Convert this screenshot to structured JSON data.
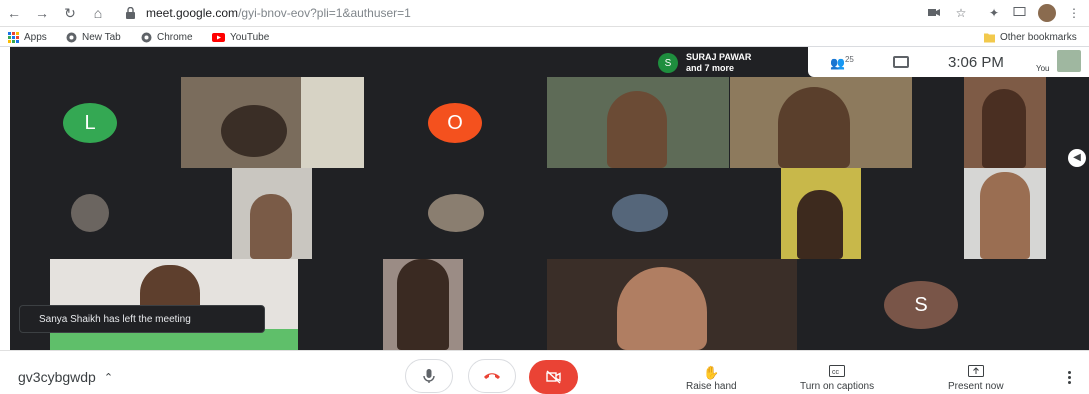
{
  "browser": {
    "url_host": "meet.google.com",
    "url_path": "/gyi-bnov-eov?pli=1&authuser=1",
    "nav_icons": [
      "back-arrow-icon",
      "forward-arrow-icon",
      "reload-icon",
      "home-icon"
    ],
    "bookmarks": [
      {
        "label": "Apps",
        "icon": "apps-grid-icon",
        "color": "#e37400"
      },
      {
        "label": "New Tab",
        "icon": "chrome-icon",
        "color": "#5f6368"
      },
      {
        "label": "Chrome",
        "icon": "chrome-icon",
        "color": "#5f6368"
      },
      {
        "label": "YouTube",
        "icon": "youtube-icon",
        "color": "#ff0000"
      }
    ],
    "other_bookmarks": "Other bookmarks"
  },
  "meet": {
    "participants_chip": {
      "initial": "S",
      "name": "SURAJ PAWAR",
      "more": "and 7 more"
    },
    "participant_count": "25",
    "time": "3:06 PM",
    "you_label": "You",
    "toast": "Sanya Shaikh has left the meeting",
    "tiles": [
      {
        "type": "initial",
        "letter": "L",
        "color": "#34a853"
      },
      {
        "type": "initial",
        "letter": "O",
        "color": "#f4511e"
      },
      {
        "type": "initial",
        "letter": "S",
        "color": "#795548"
      }
    ]
  },
  "bottom_bar": {
    "meeting_code": "gv3cybgwdp",
    "raise_hand": "Raise hand",
    "captions": "Turn on captions",
    "present": "Present now"
  }
}
